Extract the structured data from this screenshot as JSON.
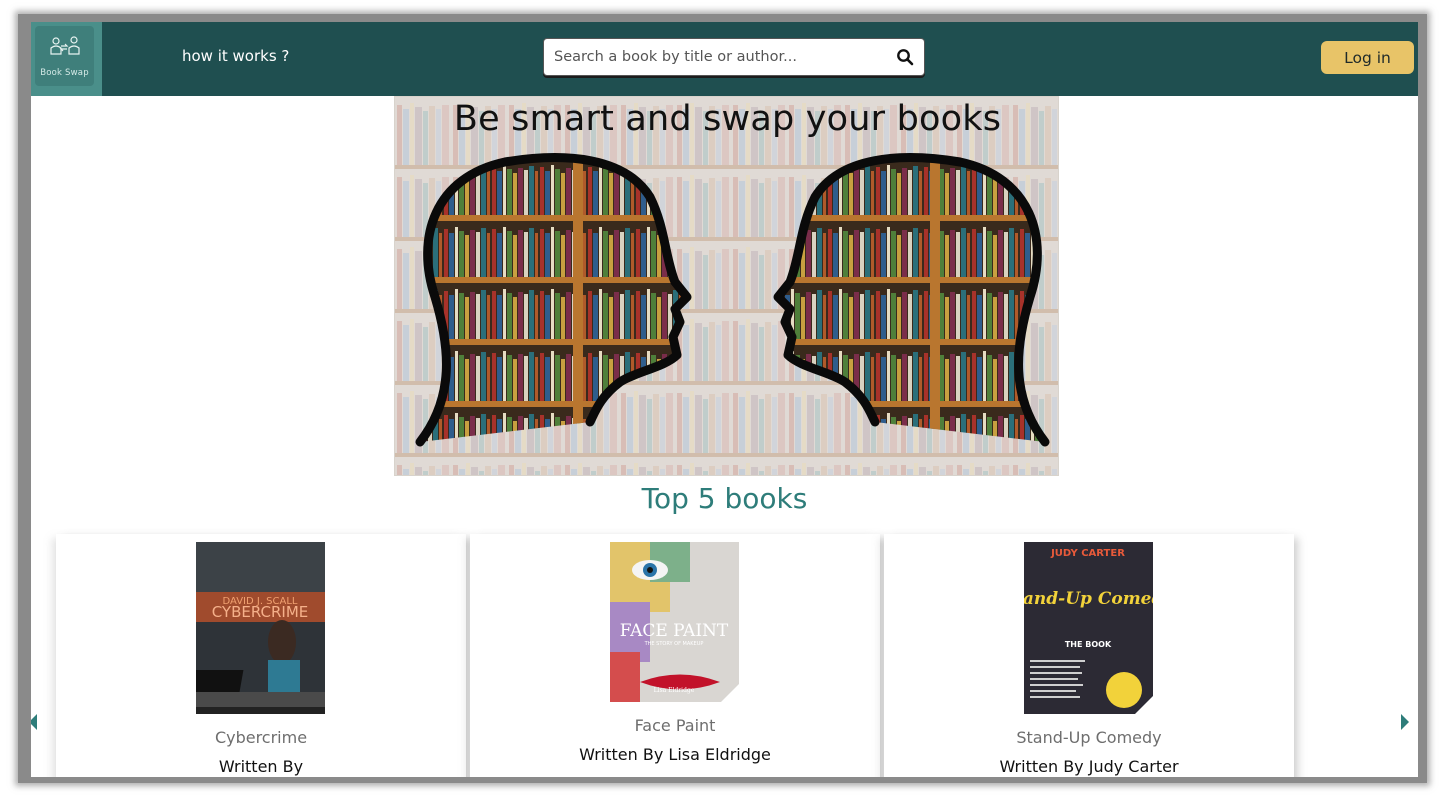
{
  "brand": {
    "logo_text": "Book Swap"
  },
  "nav": {
    "how_it_works": "how it works ?"
  },
  "search": {
    "placeholder": "Search a book by title or author..."
  },
  "auth": {
    "login_label": "Log in"
  },
  "hero": {
    "caption": "Be smart and swap your books"
  },
  "top_books": {
    "title": "Top 5 books",
    "books": [
      {
        "title": "Cybercrime",
        "author": "Written By",
        "cover_text_top": "DAVID J. SCALL",
        "cover_text": "CYBERCRIME"
      },
      {
        "title": "Face Paint",
        "author": "Written By Lisa Eldridge",
        "cover_text": "FACE PAINT",
        "cover_sub": "THE STORY OF MAKEUP",
        "cover_author": "Lisa Eldridge"
      },
      {
        "title": "Stand-Up Comedy",
        "author": "Written By Judy Carter",
        "cover_author": "JUDY CARTER",
        "cover_text": "Stand-Up Comedy",
        "cover_sub": "THE BOOK"
      }
    ]
  },
  "colors": {
    "navbar": "#1f4f50",
    "accent": "#2e7d7a",
    "login": "#e8c468"
  }
}
